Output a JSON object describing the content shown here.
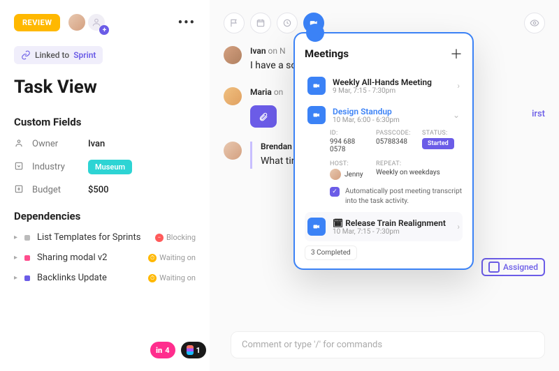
{
  "header": {
    "review_label": "REVIEW"
  },
  "linked": {
    "prefix": "Linked to",
    "target": "Sprint"
  },
  "title": "Task View",
  "custom_fields": {
    "heading": "Custom Fields",
    "owner": {
      "label": "Owner",
      "value": "Ivan"
    },
    "industry": {
      "label": "Industry",
      "value": "Museum"
    },
    "budget": {
      "label": "Budget",
      "value": "$500"
    }
  },
  "dependencies": {
    "heading": "Dependencies",
    "items": [
      {
        "label": "List Templates for Sprints",
        "status": "Blocking",
        "status_color": "red",
        "dot": "grey"
      },
      {
        "label": "Sharing modal v2",
        "status": "Waiting on",
        "status_color": "yellow",
        "dot": "pink"
      },
      {
        "label": "Backlinks Update",
        "status": "Waiting on",
        "status_color": "yellow",
        "dot": "purple"
      }
    ]
  },
  "comments": [
    {
      "author": "Ivan",
      "meta": "on N",
      "text": "I have a                                                                  somewhere for what"
    },
    {
      "author": "Maria",
      "meta": "on",
      "text": "",
      "suffix": "irst"
    },
    {
      "author": "Brendan",
      "meta": "",
      "text": "What tir                                                                 update overview"
    }
  ],
  "assigned_label": "Assigned",
  "meetings": {
    "title": "Meetings",
    "items": [
      {
        "title": "Weekly All-Hands Meeting",
        "time": "9 Mar, 7:15 - 7:30pm"
      },
      {
        "title": "Design Standup",
        "time": "10 Mar, 6:00 - 6:30pm",
        "expanded": true,
        "id_label": "ID:",
        "id": "994 688 0578",
        "passcode_label": "PASSCODE:",
        "passcode": "05788348",
        "status_label": "STATUS:",
        "status": "Started",
        "host_label": "HOST:",
        "host": "Jenny",
        "repeat_label": "REPEAT:",
        "repeat": "Weekly on weekdays",
        "transcript_note": "Automatically post meeting transcript into the task activity."
      },
      {
        "title": "Release Train Realignment",
        "time": "10 Mar, 7:15 - 7:30pm",
        "prefix_icon": "🗓"
      }
    ],
    "completed_text": "3 Completed"
  },
  "bottom": {
    "red_count": "4",
    "figma_count": "1",
    "comment_placeholder": "Comment or type '/' for commands"
  }
}
